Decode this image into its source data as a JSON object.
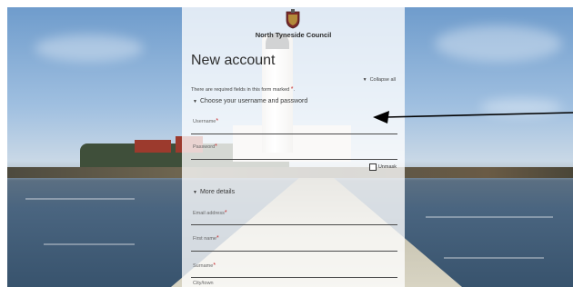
{
  "council": {
    "name": "North Tyneside Council",
    "crest_icon": "council-crest-icon"
  },
  "form": {
    "title": "New account",
    "collapse_all": "Collapse all",
    "required_note": "There are required fields in this form marked",
    "required_marker": "*",
    "sections": [
      {
        "label": "Choose your username and password",
        "fields": [
          {
            "label": "Username",
            "required": true
          },
          {
            "label": "Password",
            "required": true
          }
        ],
        "unmask_label": "Unmask"
      },
      {
        "label": "More details",
        "fields": [
          {
            "label": "Email address",
            "required": true
          },
          {
            "label": "First name",
            "required": true
          },
          {
            "label": "Surname",
            "required": true
          },
          {
            "label": "City/town",
            "required": false
          }
        ]
      }
    ]
  },
  "colors": {
    "required": "#c62828",
    "panel": "rgba(255,255,255,0.78)"
  }
}
